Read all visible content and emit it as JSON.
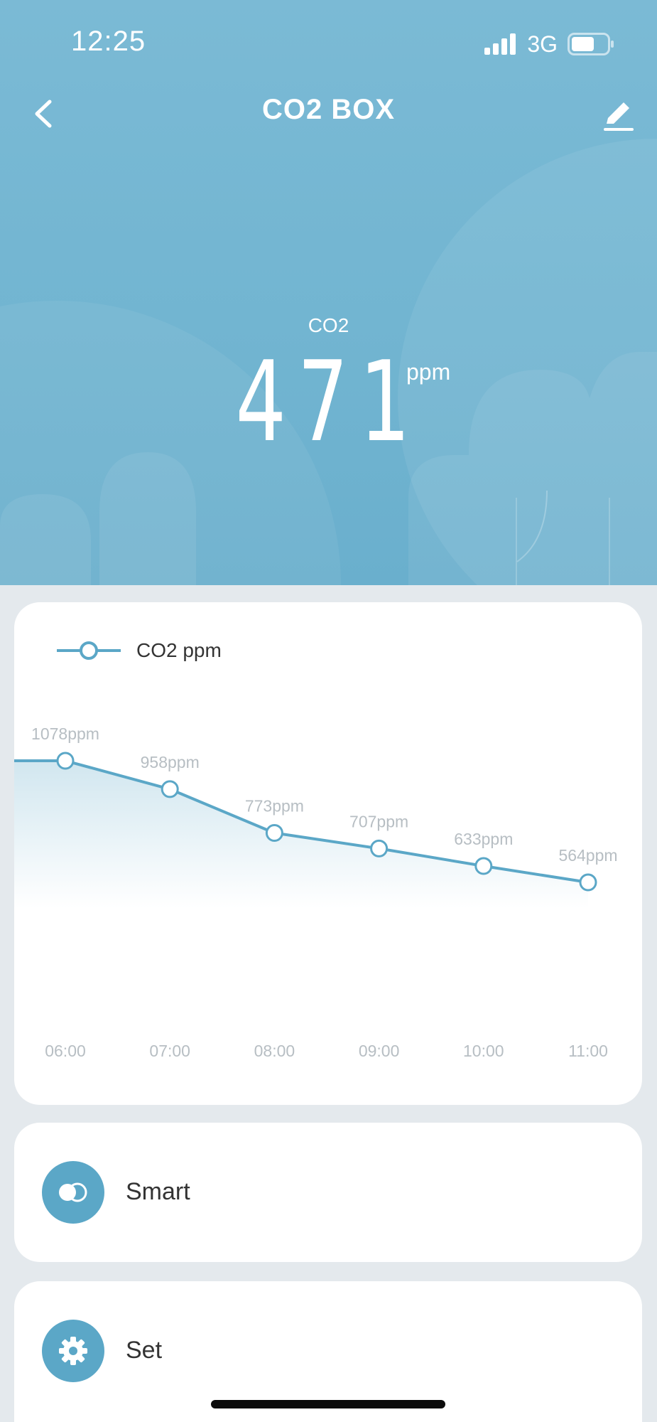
{
  "status_bar": {
    "time": "12:25",
    "network": "3G",
    "battery_level": 0.65
  },
  "nav": {
    "title": "CO2 BOX",
    "back_icon": "chevron-left-icon",
    "edit_icon": "pencil-icon"
  },
  "reading": {
    "label": "CO2",
    "value": "471",
    "unit": "ppm"
  },
  "chart_data": {
    "type": "line",
    "categories": [
      "06:00",
      "07:00",
      "08:00",
      "09:00",
      "10:00",
      "11:00"
    ],
    "series": [
      {
        "name": "CO2 ppm",
        "values": [
          1078,
          958,
          773,
          707,
          633,
          564
        ]
      }
    ],
    "data_labels": [
      "1078ppm",
      "958ppm",
      "773ppm",
      "707ppm",
      "633ppm",
      "564ppm"
    ],
    "ylim": [
      0,
      1200
    ],
    "grid": false,
    "legend": "top-left",
    "color": "#5ba7c7"
  },
  "actions": [
    {
      "label": "Smart",
      "icon": "toggle-icon"
    },
    {
      "label": "Set",
      "icon": "gear-icon"
    }
  ],
  "colors": {
    "accent": "#5ba7c7",
    "hero": "#74b6d2",
    "background": "#e4e9ed"
  }
}
